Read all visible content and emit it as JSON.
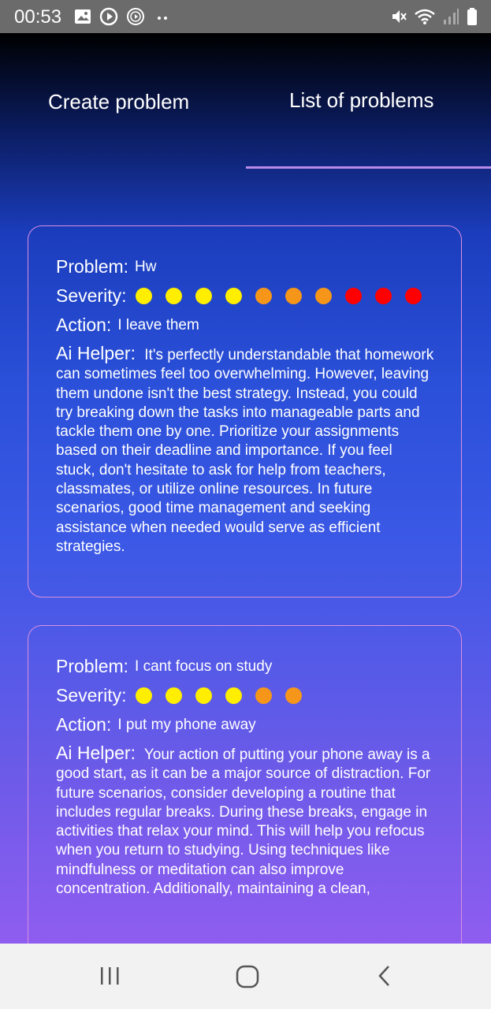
{
  "status_bar": {
    "time": "00:53",
    "left_icons": [
      "image-icon",
      "play-icon",
      "media-icon",
      "more-dots-icon"
    ],
    "right_icons": [
      "mute-icon",
      "wifi-icon",
      "signal-icon",
      "battery-icon"
    ]
  },
  "tabs": [
    {
      "label": "Create problem",
      "selected": false
    },
    {
      "label": "List of problems",
      "selected": true
    }
  ],
  "labels": {
    "problem": "Problem:",
    "severity": "Severity:",
    "action": "Action:",
    "ai_helper": "Ai Helper:"
  },
  "colors": {
    "yellow": "#ffee00",
    "orange": "#f5961a",
    "red": "#ff0000",
    "card_border": "#d98fe0",
    "tab_indicator": "#b88be8"
  },
  "problems": [
    {
      "problem": "Hw",
      "severity": 10,
      "severity_colors": [
        "yellow",
        "yellow",
        "yellow",
        "yellow",
        "orange",
        "orange",
        "orange",
        "red",
        "red",
        "red"
      ],
      "action": "I leave them",
      "ai_helper": "It's perfectly understandable that homework can sometimes feel too overwhelming. However, leaving them undone isn't the best strategy. Instead, you could try breaking down the tasks into manageable parts and tackle them one by one. Prioritize your assignments based on their deadline and importance. If you feel stuck, don't hesitate to ask for help from teachers, classmates, or utilize online resources. In future scenarios, good time management and seeking assistance when needed would serve as efficient strategies."
    },
    {
      "problem": "I cant focus on study",
      "severity": 6,
      "severity_colors": [
        "yellow",
        "yellow",
        "yellow",
        "yellow",
        "orange",
        "orange"
      ],
      "action": "I put my phone away",
      "ai_helper": "Your action of putting your phone away is a good start, as it can be a major source of distraction. For future scenarios, consider developing a routine that includes regular breaks. During these breaks, engage in activities that relax your mind. This will help you refocus when you return to studying. Using techniques like mindfulness or meditation can also improve concentration. Additionally, maintaining a clean,"
    }
  ],
  "nav_bar": [
    "recent-apps-icon",
    "home-icon",
    "back-icon"
  ]
}
